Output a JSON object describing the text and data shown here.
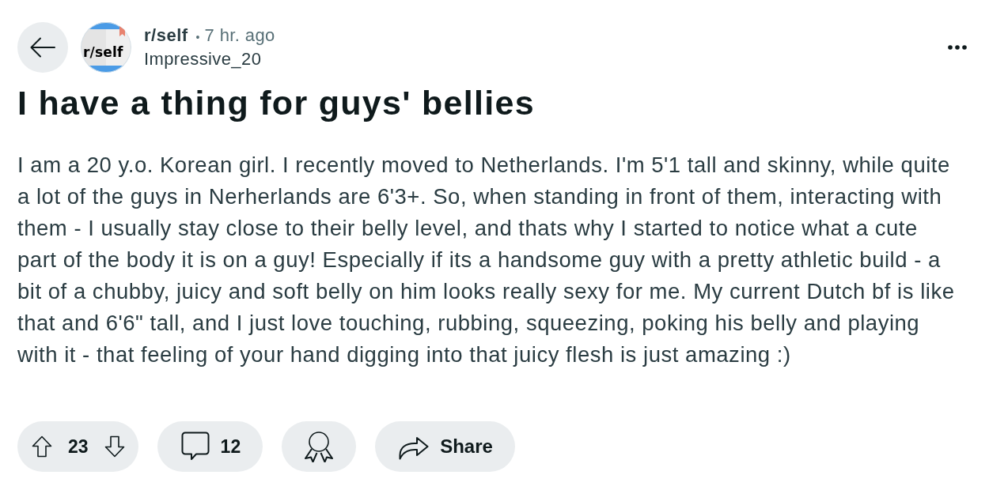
{
  "post": {
    "community": "r/self",
    "separator": "•",
    "time": "7 hr. ago",
    "author": "Impressive_20",
    "avatar_label": "r/self",
    "title": "I have a thing for guys' bellies",
    "body": "I am a 20 y.o. Korean girl. I recently moved to Netherlands. I'm 5'1 tall and skinny, while quite a lot of the guys in Nerherlands are 6'3+. So, when standing in front of them, interacting with them - I usually stay close to their belly level, and thats why I started to notice what a cute part of the body it is on a guy! Especially if its a handsome guy with a pretty athletic build - a bit of a chubby, juicy and soft belly on him looks really sexy for me. My current Dutch bf is like that and 6'6\" tall, and I just love touching, rubbing, squeezing, poking his belly and playing with it - that feeling of your hand digging into that juicy flesh is just amazing :)"
  },
  "actions": [
    {
      "kind": "vote",
      "count": "23"
    },
    {
      "kind": "comment",
      "count": "12"
    },
    {
      "kind": "award"
    },
    {
      "kind": "share",
      "label": "Share"
    }
  ]
}
